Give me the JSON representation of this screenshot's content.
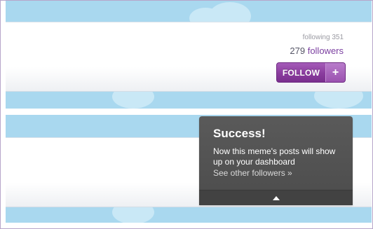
{
  "profile": {
    "following_label": "following 351",
    "followers_count": "279",
    "followers_label": "followers"
  },
  "follow_button": {
    "label": "FOLLOW",
    "plus": "+"
  },
  "success_popup": {
    "title": "Success!",
    "message": "Now this meme's posts will show up on your dashboard",
    "link": "See other followers »"
  },
  "colors": {
    "sky": "#a9d8ef",
    "follow_purple": "#8a3c9e",
    "followers_link": "#7b3fa0",
    "popup_bg": "#4c4c4c"
  },
  "icons": {
    "collapse": "caret-up-icon"
  }
}
